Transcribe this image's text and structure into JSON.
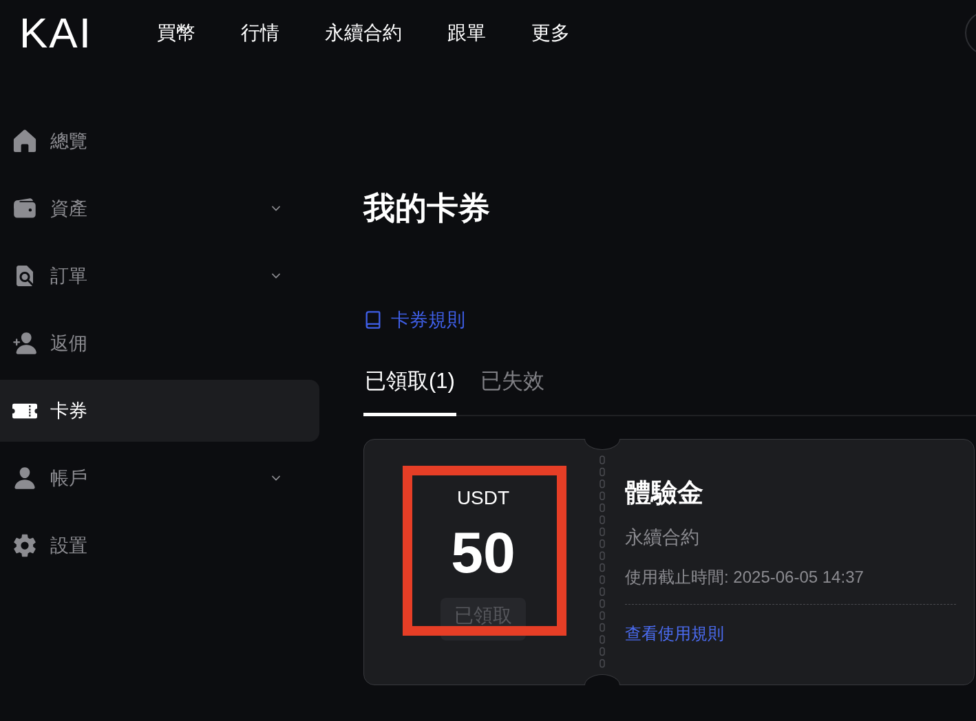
{
  "header": {
    "logo": "KAI",
    "nav": [
      {
        "label": "買幣"
      },
      {
        "label": "行情"
      },
      {
        "label": "永續合約"
      },
      {
        "label": "跟單"
      },
      {
        "label": "更多"
      }
    ]
  },
  "sidebar": {
    "items": [
      {
        "label": "總覽",
        "selected": false,
        "expandable": false
      },
      {
        "label": "資產",
        "selected": false,
        "expandable": true
      },
      {
        "label": "訂單",
        "selected": false,
        "expandable": true
      },
      {
        "label": "返佣",
        "selected": false,
        "expandable": false
      },
      {
        "label": "卡券",
        "selected": true,
        "expandable": false
      },
      {
        "label": "帳戶",
        "selected": false,
        "expandable": true
      },
      {
        "label": "設置",
        "selected": false,
        "expandable": false
      }
    ]
  },
  "page": {
    "title": "我的卡券",
    "rules_link": "卡券規則",
    "tabs": [
      {
        "label": "已領取(1)",
        "selected": true
      },
      {
        "label": "已失效",
        "selected": false
      }
    ],
    "coupons": [
      {
        "currency": "USDT",
        "amount": "50",
        "status_button": {
          "label": "已領取",
          "disabled": true
        },
        "highlighted": true,
        "name": "體驗金",
        "category": "永續合約",
        "expiry": "使用截止時間: 2025-06-05 14:37",
        "details_link": "查看使用規則"
      }
    ]
  }
}
